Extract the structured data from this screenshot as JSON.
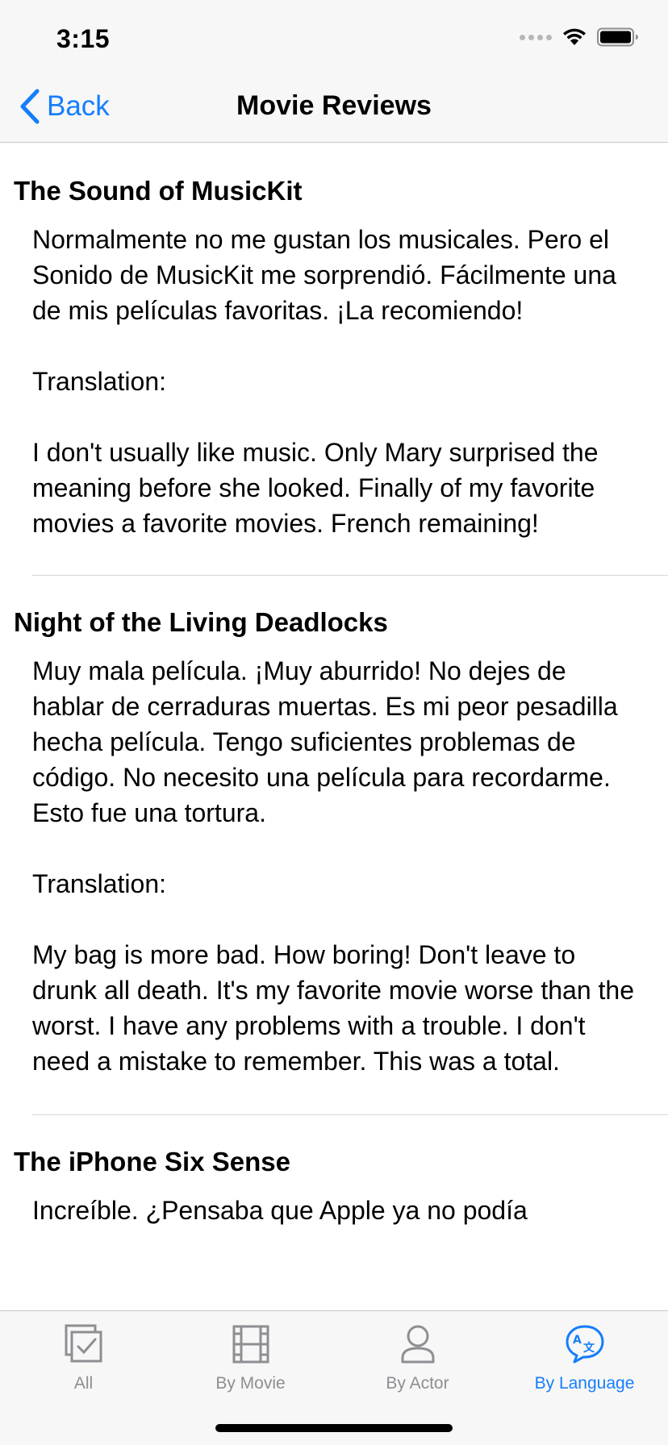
{
  "status": {
    "time": "3:15"
  },
  "nav": {
    "back_label": "Back",
    "title": "Movie Reviews"
  },
  "reviews": [
    {
      "title": "The Sound of MusicKit",
      "body": "Normalmente no me gustan los musicales. Pero el Sonido de MusicKit me sorprendió. Fácilmente una de mis películas favoritas. ¡La recomiendo!\n\nTranslation:\n\nI don't usually like music. Only Mary surprised the meaning before she looked. Finally of my favorite movies a favorite movies. French remaining!"
    },
    {
      "title": "Night of the Living Deadlocks",
      "body": "Muy mala película. ¡Muy aburrido! No dejes de hablar de cerraduras muertas. Es mi peor pesadilla hecha película. Tengo suficientes problemas de código. No necesito una película para recordarme. Esto fue una tortura.\n\nTranslation:\n\nMy bag is more bad. How boring! Don't leave to drunk all death. It's my favorite movie worse than the worst. I have any problems with a trouble. I don't need a mistake to remember. This was a total."
    },
    {
      "title": "The iPhone Six Sense",
      "body": "Increíble. ¿Pensaba que Apple ya no podía"
    }
  ],
  "tabs": [
    {
      "label": "All",
      "icon": "checklist-icon",
      "active": false
    },
    {
      "label": "By Movie",
      "icon": "film-icon",
      "active": false
    },
    {
      "label": "By Actor",
      "icon": "person-icon",
      "active": false
    },
    {
      "label": "By Language",
      "icon": "translate-icon",
      "active": true
    }
  ],
  "colors": {
    "accent": "#157efb",
    "inactive": "#8e8e93",
    "bar_background": "#f7f7f7"
  }
}
